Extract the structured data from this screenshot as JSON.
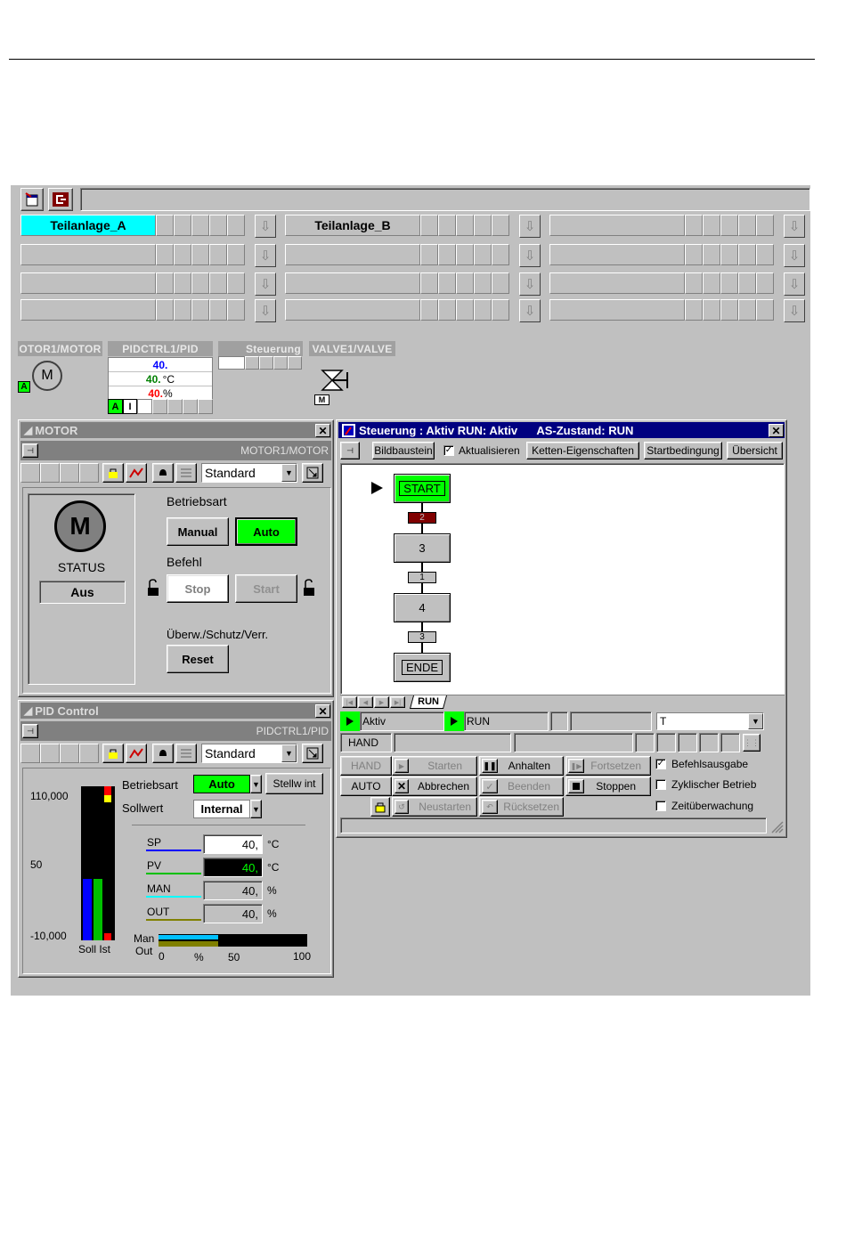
{
  "top_bar": {
    "areas": [
      {
        "name": "Teilanlage_A",
        "active": true
      },
      {
        "name": "Teilanlage_B",
        "active": false
      },
      {
        "name": "",
        "active": false
      }
    ]
  },
  "faceplates": {
    "motor_tag": "OTOR1/MOTOR",
    "pid_tag": "PIDCTRL1/PID",
    "steuerung_tag": "Steuerung",
    "valve_tag": "VALVE1/VALVE",
    "motor_symbol": "M",
    "motor_auto_badge": "A",
    "valve_badge": "M",
    "pid_values": [
      "40.",
      "40.",
      "40."
    ],
    "pid_units": [
      "",
      "°C",
      "%"
    ],
    "pid_colors": [
      "#0000ff",
      "#008000",
      "#ff0000"
    ],
    "pid_auto_badge": "A",
    "pid_internal_badge": "I"
  },
  "motor_window": {
    "title": "MOTOR",
    "tag": "MOTOR1/MOTOR",
    "view_select": "Standard",
    "motor_symbol": "M",
    "status_label": "STATUS",
    "status_value": "Aus",
    "betriebsart_label": "Betriebsart",
    "manual_btn": "Manual",
    "auto_btn": "Auto",
    "befehl_label": "Befehl",
    "stop_btn": "Stop",
    "start_btn": "Start",
    "uberw_label": "Überw./Schutz/Verr.",
    "reset_btn": "Reset"
  },
  "pid_window": {
    "title": "PID Control",
    "tag": "PIDCTRL1/PID",
    "view_select": "Standard",
    "scale_top": "110,000",
    "scale_mid": "50",
    "scale_bottom": "-10,000",
    "bar_soll": 0.4,
    "bar_ist": 0.4,
    "bar_labels": "Soll Ist",
    "betriebsart_label": "Betriebsart",
    "betriebsart_value": "Auto",
    "stellw_btn": "Stellw int",
    "sollwert_label": "Sollwert",
    "sollwert_value": "Internal",
    "rows": [
      {
        "label": "SP",
        "value": "40,",
        "unit": "°C",
        "line": "#0000ff"
      },
      {
        "label": "PV",
        "value": "40,",
        "unit": "°C",
        "line": "#00c000"
      },
      {
        "label": "MAN",
        "value": "40,",
        "unit": "%",
        "line": "#00ffff"
      },
      {
        "label": "OUT",
        "value": "40,",
        "unit": "%",
        "line": "#808000"
      }
    ],
    "man_label": "Man",
    "out_label": "Out",
    "man_fraction": 0.4,
    "out_fraction": 0.4,
    "axis_0": "0",
    "axis_pct": "%",
    "axis_50": "50",
    "axis_100": "100"
  },
  "steuerung_window": {
    "title": "Steuerung : Aktiv RUN: Aktiv      AS-Zustand: RUN",
    "btn_bildbaustein": "Bildbaustein",
    "chk_aktualisieren": "Aktualisieren",
    "btn_ketten": "Ketten-Eigenschaften",
    "btn_startbedingung": "Startbedingung",
    "btn_ubersicht": "Übersicht",
    "steps": [
      "START",
      "3",
      "4",
      "ENDE"
    ],
    "transitions": [
      "2",
      "1",
      "3"
    ],
    "tab_run": "RUN",
    "status_aktiv": "Aktiv",
    "status_run": "RUN",
    "status_t": "T",
    "hand_label": "HAND",
    "ctrl_hand": "HAND",
    "ctrl_auto": "AUTO",
    "btn_starten": "Starten",
    "btn_anhalten": "Anhalten",
    "btn_fortsetzen": "Fortsetzen",
    "btn_abbrechen": "Abbrechen",
    "btn_beenden": "Beenden",
    "btn_stoppen": "Stoppen",
    "btn_neustarten": "Neustarten",
    "btn_rucksetzen": "Rücksetzen",
    "opt_befehlsausgabe": "Befehlsausgabe",
    "opt_zyklischer": "Zyklischer Betrieb",
    "opt_zeit": "Zeitüberwachung"
  }
}
